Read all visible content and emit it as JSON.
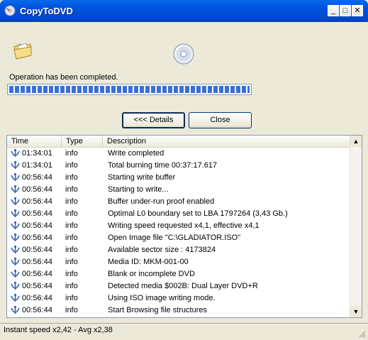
{
  "window": {
    "title": "CopyToDVD",
    "minimize_label": "_",
    "maximize_label": "□",
    "close_label": "✕"
  },
  "status": {
    "message": "Operation has been completed.",
    "progress": 1.0
  },
  "buttons": {
    "details_label": "<<< Details",
    "close_label": "Close"
  },
  "log": {
    "columns": [
      "Time",
      "Type",
      "Description"
    ],
    "rows": [
      {
        "time": "01:34:01",
        "type": "info",
        "desc": "Write completed"
      },
      {
        "time": "01:34:01",
        "type": "info",
        "desc": "Total burning time 00:37:17.617"
      },
      {
        "time": "00:56:44",
        "type": "info",
        "desc": "Starting write buffer"
      },
      {
        "time": "00:56:44",
        "type": "info",
        "desc": "Starting to write..."
      },
      {
        "time": "00:56:44",
        "type": "info",
        "desc": "Buffer under-run proof enabled"
      },
      {
        "time": "00:56:44",
        "type": "info",
        "desc": "Optimal L0 boundary set to LBA 1797264 (3,43 Gb.)"
      },
      {
        "time": "00:56:44",
        "type": "info",
        "desc": "Writing speed requested x4,1, effective x4,1"
      },
      {
        "time": "00:56:44",
        "type": "info",
        "desc": "Open Image file \"C:\\GLADIATOR.ISO\""
      },
      {
        "time": "00:56:44",
        "type": "info",
        "desc": "Available sector size : 4173824"
      },
      {
        "time": "00:56:44",
        "type": "info",
        "desc": "Media ID: MKM-001-00"
      },
      {
        "time": "00:56:44",
        "type": "info",
        "desc": "Blank or incomplete DVD"
      },
      {
        "time": "00:56:44",
        "type": "info",
        "desc": "Detected media $002B: Dual Layer DVD+R"
      },
      {
        "time": "00:56:44",
        "type": "info",
        "desc": "Using ISO image writing mode."
      },
      {
        "time": "00:56:44",
        "type": "info",
        "desc": "Start Browsing file structures"
      }
    ]
  },
  "statusbar": {
    "text": "Instant speed x2,42 - Avg x2,38"
  }
}
